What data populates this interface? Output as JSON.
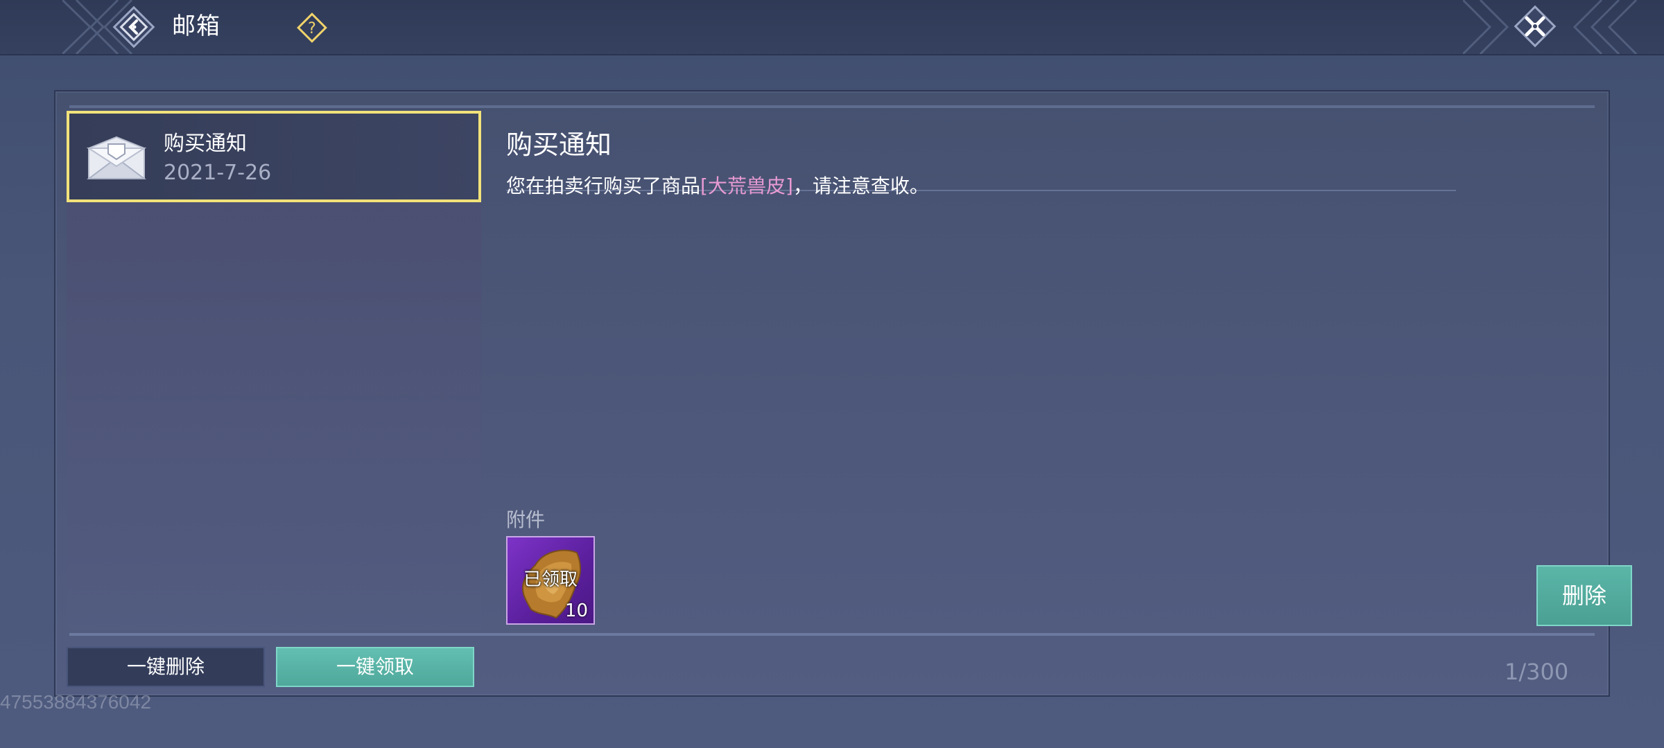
{
  "header": {
    "title": "邮箱",
    "back_icon": "back-arrow-icon",
    "help_icon": "help-question-icon",
    "close_icon": "close-x-icon"
  },
  "mail_list": {
    "items": [
      {
        "title": "购买通知",
        "date": "2021-7-26",
        "icon": "envelope-icon",
        "selected": true
      }
    ]
  },
  "mail": {
    "title": "购买通知",
    "body_prefix": "您在拍卖行购买了商品",
    "item_name": "[大荒兽皮]",
    "body_suffix": "，请注意查收。",
    "attachments_label": "附件",
    "attachment": {
      "icon": "beast-hide-icon",
      "status": "已领取",
      "count": "10"
    },
    "delete_label": "删除"
  },
  "footer": {
    "delete_all_label": "一键删除",
    "claim_all_label": "一键领取",
    "count": "1/300"
  },
  "watermark": "47553884376042",
  "colors": {
    "selected_border": "#f2e27a",
    "accent_button": "#5bb6a8",
    "item_highlight": "#e79ad3",
    "rarity_purple": "#7d33c8"
  }
}
